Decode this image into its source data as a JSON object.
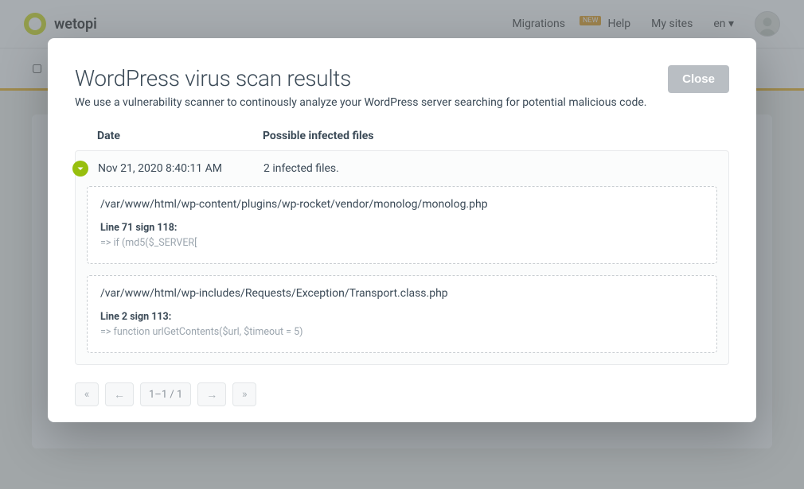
{
  "bg": {
    "brand": "wetopi",
    "nav": {
      "migrations": "Migrations",
      "migrations_badge": "NEW",
      "help": "Help",
      "my_sites": "My sites",
      "lang": "en"
    }
  },
  "modal": {
    "title": "WordPress virus scan results",
    "subtitle": "We use a vulnerability scanner to continously analyze your WordPress server searching for potential malicious code.",
    "close_label": "Close",
    "columns": {
      "date": "Date",
      "files": "Possible infected files"
    },
    "row": {
      "date": "Nov 21, 2020 8:40:11 AM",
      "summary": "2 infected files."
    },
    "infections": [
      {
        "path": "/var/www/html/wp-content/plugins/wp-rocket/vendor/monolog/monolog.php",
        "sign_label": "Line 71 sign 118:",
        "snippet": "=> if (md5($_SERVER["
      },
      {
        "path": "/var/www/html/wp-includes/Requests/Exception/Transport.class.php",
        "sign_label": "Line 2 sign 113:",
        "snippet": "=> function urlGetContents($url, $timeout = 5)"
      }
    ],
    "pager": {
      "first": "«",
      "prev": "←",
      "status": "1–1 / 1",
      "next": "→",
      "last": "»"
    }
  }
}
